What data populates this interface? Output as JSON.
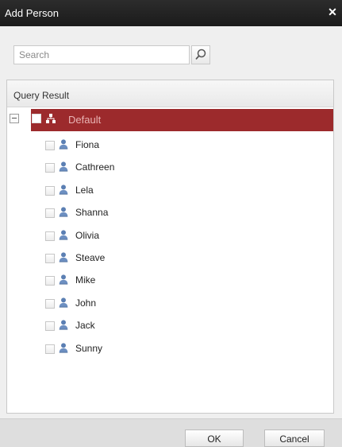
{
  "dialog": {
    "title": "Add Person"
  },
  "search": {
    "placeholder": "Search",
    "value": ""
  },
  "panel": {
    "header": "Query Result"
  },
  "tree": {
    "root_label": "Default",
    "items": [
      {
        "name": "Fiona"
      },
      {
        "name": "Cathreen"
      },
      {
        "name": "Lela"
      },
      {
        "name": "Shanna"
      },
      {
        "name": "Olivia"
      },
      {
        "name": "Steave"
      },
      {
        "name": "Mike"
      },
      {
        "name": "John"
      },
      {
        "name": "Jack"
      },
      {
        "name": "Sunny"
      }
    ]
  },
  "buttons": {
    "ok": "OK",
    "cancel": "Cancel"
  },
  "colors": {
    "selected_row": "#9c2a2c",
    "title_bar": "#1e1e1e"
  },
  "icons": {
    "close": "close-icon",
    "search": "magnifier-icon",
    "group": "org-tree-icon",
    "person": "person-icon"
  }
}
